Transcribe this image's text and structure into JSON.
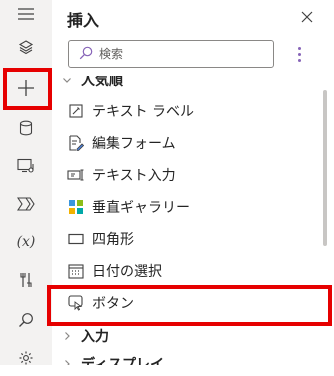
{
  "colors": {
    "highlight": "#e60000",
    "accent": "#8764b8",
    "rail_bg": "#f3f2f1"
  },
  "rail": {
    "items": [
      {
        "icon": "hamburger-menu-icon"
      },
      {
        "icon": "layers-icon"
      },
      {
        "icon": "plus-icon",
        "selected": true
      },
      {
        "icon": "database-icon"
      },
      {
        "icon": "media-icon"
      },
      {
        "icon": "power-automate-icon"
      },
      {
        "icon": "variable-icon",
        "label": "(x)"
      },
      {
        "icon": "tools-icon"
      },
      {
        "icon": "search-icon"
      },
      {
        "icon": "settings-icon"
      }
    ]
  },
  "pane": {
    "title": "挿入",
    "close_icon": "close-icon",
    "search": {
      "placeholder": "検索",
      "value": ""
    },
    "more_icon": "more-vertical-icon",
    "sections": [
      {
        "label": "人気順",
        "expanded": true
      },
      {
        "label": "入力",
        "expanded": false
      },
      {
        "label": "ディスプレイ",
        "expanded": false
      }
    ],
    "items": [
      {
        "label": "テキスト ラベル",
        "icon": "text-label-icon"
      },
      {
        "label": "編集フォーム",
        "icon": "edit-form-icon"
      },
      {
        "label": "テキスト入力",
        "icon": "text-input-icon"
      },
      {
        "label": "垂直ギャラリー",
        "icon": "gallery-icon"
      },
      {
        "label": "四角形",
        "icon": "rectangle-icon"
      },
      {
        "label": "日付の選択",
        "icon": "calendar-icon"
      },
      {
        "label": "ボタン",
        "icon": "button-icon",
        "highlighted": true
      }
    ]
  }
}
